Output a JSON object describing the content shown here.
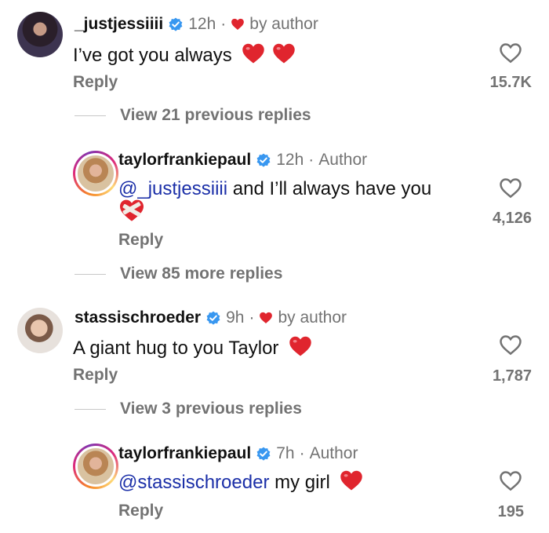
{
  "comments": [
    {
      "username": "_justjessiiii",
      "time": "12h",
      "separator": "·",
      "liked_by": "by author",
      "text": "I’ve got you always",
      "reply": "Reply",
      "likes": "15.7K",
      "icon": "heart-emoji"
    },
    {
      "username": "taylorfrankiepaul",
      "time": "12h",
      "separator": "·",
      "author_tag": "Author",
      "mention": "@_justjessiiii",
      "text": " and I’ll always have you",
      "reply": "Reply",
      "likes": "4,126",
      "icon": "mending-heart-emoji"
    },
    {
      "username": "stassischroeder",
      "time": "9h",
      "separator": "·",
      "liked_by": "by author",
      "text": "A giant hug to you Taylor",
      "reply": "Reply",
      "likes": "1,787",
      "icon": "heart-emoji"
    },
    {
      "username": "taylorfrankiepaul",
      "time": "7h",
      "separator": "·",
      "author_tag": "Author",
      "mention": "@stassischroeder",
      "text": " my girl",
      "reply": "Reply",
      "likes": "195",
      "icon": "heart-emoji"
    }
  ],
  "view_more": [
    "View 21 previous replies",
    "View 85 more replies",
    "View 3 previous replies"
  ],
  "colors": {
    "verified": "#3897f0",
    "heart": "#e0252e",
    "mention": "#1b2fa8",
    "muted": "#737373"
  }
}
